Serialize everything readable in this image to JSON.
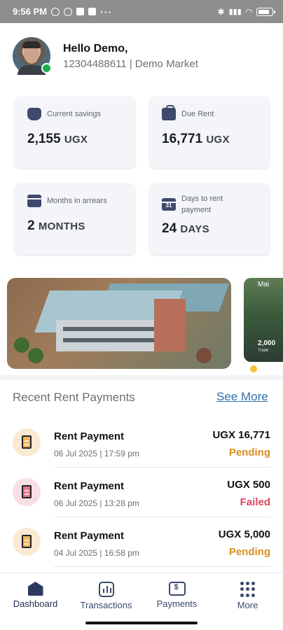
{
  "status_bar": {
    "time": "9:56 PM",
    "dots": "···",
    "battery_level": 0.7
  },
  "user": {
    "greeting": "Hello Demo,",
    "subtitle": "12304488611 | Demo Market"
  },
  "stats": [
    {
      "label": "Current savings",
      "value": "2,155",
      "unit": "UGX",
      "icon": "piggy-bank-icon"
    },
    {
      "label": "Due Rent",
      "value": "16,771",
      "unit": "UGX",
      "icon": "bag-icon"
    },
    {
      "label": "Months in arrears",
      "value": "2",
      "unit": "MONTHS",
      "icon": "calendar-icon"
    },
    {
      "label": "Days to rent payment",
      "value": "24",
      "unit": "DAYS",
      "icon": "calendar-31-icon",
      "icon_text": "31"
    }
  ],
  "banner_next": {
    "line1": "Mai",
    "line2": "2,000",
    "line3": "Trade"
  },
  "recent": {
    "title": "Recent Rent Payments",
    "see_more": "See More",
    "items": [
      {
        "title": "Rent Payment",
        "date": "06 Jul 2025 | 17:59 pm",
        "amount": "UGX 16,771",
        "status": "Pending"
      },
      {
        "title": "Rent Payment",
        "date": "06 Jul 2025 | 13:28 pm",
        "amount": "UGX 500",
        "status": "Failed"
      },
      {
        "title": "Rent Payment",
        "date": "04 Jul 2025 | 16:58 pm",
        "amount": "UGX 5,000",
        "status": "Pending"
      }
    ]
  },
  "nav": [
    {
      "label": "Dashboard",
      "icon": "home-icon",
      "active": true
    },
    {
      "label": "Transactions",
      "icon": "chart-icon"
    },
    {
      "label": "Payments",
      "icon": "payment-icon"
    },
    {
      "label": "More",
      "icon": "grid-dots-icon"
    }
  ],
  "colors": {
    "pending": "#d98f22",
    "failed": "#e0455f",
    "link": "#2f6fa8",
    "nav": "#3a4a6b"
  }
}
